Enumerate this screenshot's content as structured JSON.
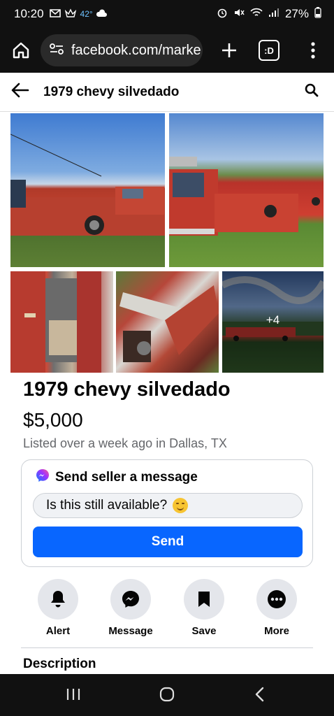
{
  "status_bar": {
    "time": "10:20",
    "temperature": "42°",
    "battery": "27%"
  },
  "browser": {
    "url": "facebook.com/marke",
    "tab_count": ":D"
  },
  "header": {
    "title": "1979 chevy silvedado"
  },
  "gallery": {
    "more_count": "+4"
  },
  "listing": {
    "title": "1979 chevy silvedado",
    "price": "$5,000",
    "listed_info": "Listed over a week ago in Dallas, TX"
  },
  "message_card": {
    "heading": "Send seller a message",
    "input_value": "Is this still available?",
    "send_label": "Send"
  },
  "actions": [
    {
      "label": "Alert",
      "icon": "bell-icon"
    },
    {
      "label": "Message",
      "icon": "messenger-icon"
    },
    {
      "label": "Save",
      "icon": "bookmark-icon"
    },
    {
      "label": "More",
      "icon": "more-icon"
    }
  ],
  "description": {
    "heading": "Description"
  },
  "colors": {
    "accent": "#0866ff",
    "secondary_text": "#65676b",
    "chip_bg": "#e4e6eb"
  }
}
